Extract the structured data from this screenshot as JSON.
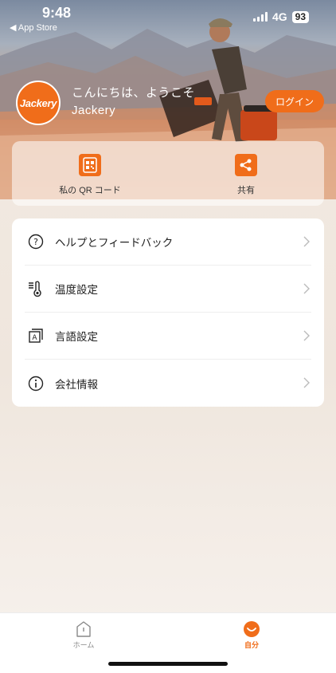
{
  "status_bar": {
    "time": "9:48",
    "back_label": "◀ App Store",
    "network": "4G",
    "battery": "93"
  },
  "profile": {
    "avatar_text": "Jackery",
    "greeting_line1": "こんにちは、ようこそ",
    "greeting_line2": "Jackery",
    "login_label": "ログイン"
  },
  "quick_actions": [
    {
      "label": "私の QR コード",
      "icon": "qr-code-icon"
    },
    {
      "label": "共有",
      "icon": "share-icon"
    }
  ],
  "menu": [
    {
      "label": "ヘルプとフィードバック",
      "icon": "help-icon"
    },
    {
      "label": "温度設定",
      "icon": "thermometer-icon"
    },
    {
      "label": "言語設定",
      "icon": "language-icon"
    },
    {
      "label": "会社情報",
      "icon": "info-icon"
    }
  ],
  "tabs": [
    {
      "label": "ホーム",
      "icon": "home-icon",
      "active": false
    },
    {
      "label": "自分",
      "icon": "me-icon",
      "active": true
    }
  ],
  "colors": {
    "accent": "#f06d1a"
  }
}
